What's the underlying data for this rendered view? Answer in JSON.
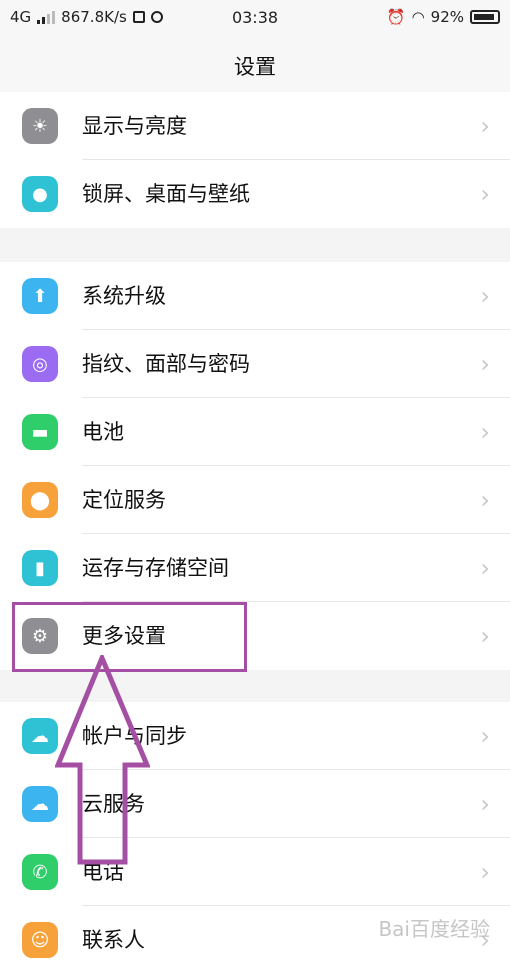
{
  "status_bar": {
    "network": "4G",
    "speed": "867.8K/s",
    "time": "03:38",
    "battery": "92%"
  },
  "header": {
    "title": "设置"
  },
  "groups": [
    {
      "items": [
        {
          "label": "显示与亮度",
          "icon": "brightness-icon",
          "color": "#8e8e93"
        },
        {
          "label": "锁屏、桌面与壁纸",
          "icon": "palette-icon",
          "color": "#2fc2d4"
        }
      ]
    },
    {
      "items": [
        {
          "label": "系统升级",
          "icon": "upgrade-icon",
          "color": "#3cb4ef"
        },
        {
          "label": "指纹、面部与密码",
          "icon": "fingerprint-icon",
          "color": "#9b6cf2"
        },
        {
          "label": "电池",
          "icon": "battery-icon",
          "color": "#2fce6a"
        },
        {
          "label": "定位服务",
          "icon": "location-icon",
          "color": "#f7a13a"
        },
        {
          "label": "运存与存储空间",
          "icon": "storage-icon",
          "color": "#2fc2d4"
        },
        {
          "label": "更多设置",
          "icon": "gear-icon",
          "color": "#8e8e93"
        }
      ]
    },
    {
      "items": [
        {
          "label": "帐户与同步",
          "icon": "account-sync-icon",
          "color": "#2fc2d4"
        },
        {
          "label": "云服务",
          "icon": "cloud-icon",
          "color": "#3cb4ef"
        },
        {
          "label": "电话",
          "icon": "phone-icon",
          "color": "#2fce6a"
        },
        {
          "label": "联系人",
          "icon": "contacts-icon",
          "color": "#f7a13a"
        }
      ]
    }
  ],
  "watermark": "Bai百度经验"
}
